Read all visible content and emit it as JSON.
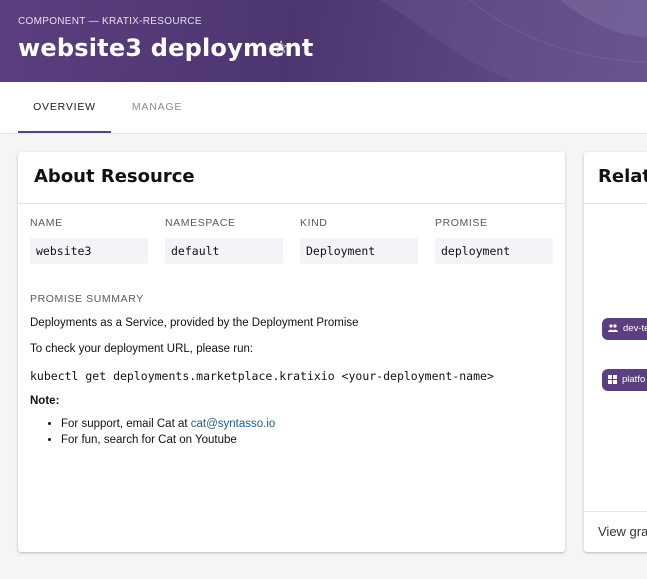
{
  "header": {
    "breadcrumb": "COMPONENT — KRATIX-RESOURCE",
    "title": "website3 deployment",
    "star_glyph": "☆"
  },
  "tabs": [
    {
      "label": "OVERVIEW",
      "active": true
    },
    {
      "label": "MANAGE",
      "active": false
    }
  ],
  "about": {
    "title": "About Resource",
    "fields": [
      {
        "label": "NAME",
        "value": "website3"
      },
      {
        "label": "NAMESPACE",
        "value": "default"
      },
      {
        "label": "KIND",
        "value": "Deployment"
      },
      {
        "label": "PROMISE",
        "value": "deployment"
      }
    ],
    "summary_label": "PROMISE SUMMARY",
    "summary": {
      "line1": "Deployments as a Service, provided by the Deployment Promise",
      "line2": "To check your deployment URL, please run:",
      "command": "kubectl get deployments.marketplace.kratixio <your-deployment-name>",
      "note_label": "Note",
      "note_colon": ":",
      "bullet1_prefix": "For support, email Cat at ",
      "bullet1_link": "cat@syntasso.io",
      "bullet2": "For fun, search for Cat on Youtube"
    }
  },
  "relations": {
    "title": "Relati",
    "chips": [
      "dev-te",
      "platfo"
    ],
    "view_graph": "View gra"
  },
  "colors": {
    "brand": "#5b3f7f",
    "link": "#1f5c99"
  }
}
